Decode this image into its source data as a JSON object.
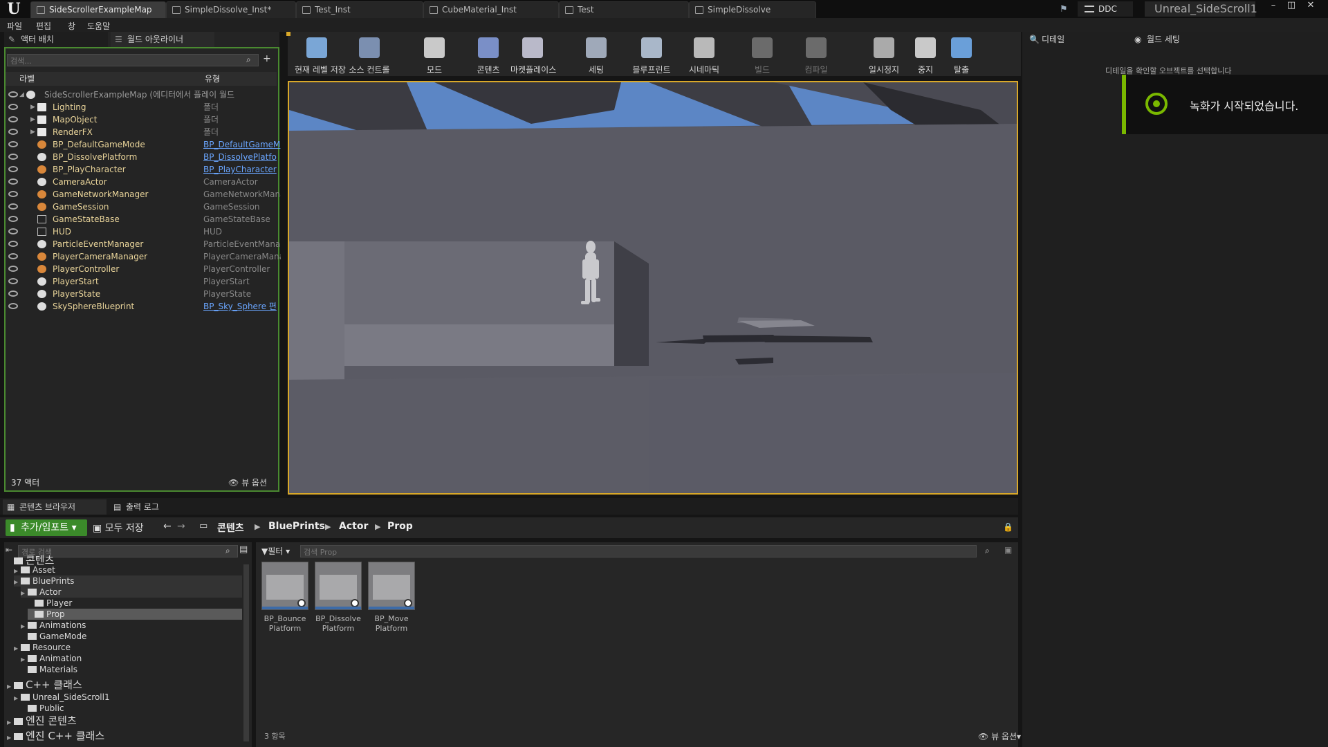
{
  "title_bar": {
    "tabs": [
      "SideScrollerExampleMap",
      "SimpleDissolve_Inst*",
      "Test_Inst",
      "CubeMaterial_Inst",
      "Test",
      "SimpleDissolve"
    ],
    "ddc": "DDC",
    "project": "Unreal_SideScroll1"
  },
  "menu": [
    "파일",
    "편집",
    "창",
    "도움말"
  ],
  "left_panel": {
    "tabs": [
      "액터 배치",
      "월드 아웃라이너"
    ],
    "search_placeholder": "검색...",
    "col_label": "라벨",
    "col_type": "유형",
    "rows": [
      {
        "label": "SideScrollerExampleMap (에디터에서 플레이 월드",
        "type": ""
      },
      {
        "label": "Lighting",
        "type": "폴더"
      },
      {
        "label": "MapObject",
        "type": "폴더"
      },
      {
        "label": "RenderFX",
        "type": "폴더"
      },
      {
        "label": "BP_DefaultGameMode",
        "type": "BP_DefaultGameM"
      },
      {
        "label": "BP_DissolvePlatform",
        "type": "BP_DissolvePlatfo"
      },
      {
        "label": "BP_PlayCharacter",
        "type": "BP_PlayCharacter"
      },
      {
        "label": "CameraActor",
        "type": "CameraActor"
      },
      {
        "label": "GameNetworkManager",
        "type": "GameNetworkManag"
      },
      {
        "label": "GameSession",
        "type": "GameSession"
      },
      {
        "label": "GameStateBase",
        "type": "GameStateBase"
      },
      {
        "label": "HUD",
        "type": "HUD"
      },
      {
        "label": "ParticleEventManager",
        "type": "ParticleEventManag"
      },
      {
        "label": "PlayerCameraManager",
        "type": "PlayerCameraMana"
      },
      {
        "label": "PlayerController",
        "type": "PlayerController"
      },
      {
        "label": "PlayerStart",
        "type": "PlayerStart"
      },
      {
        "label": "PlayerState",
        "type": "PlayerState"
      },
      {
        "label": "SkySphereBlueprint",
        "type": "BP_Sky_Sphere 편"
      }
    ],
    "actor_count": "37 액터",
    "view_options": "뷰 옵션"
  },
  "toolbar": [
    "현재 레벨 저장",
    "소스 컨트롤",
    "모드",
    "콘텐츠",
    "마켓플레이스",
    "세팅",
    "블루프린트",
    "시네마틱",
    "빌드",
    "컴파일",
    "일시정지",
    "중지",
    "탈출"
  ],
  "right_panel": {
    "tabs": [
      "디테일",
      "월드 세팅"
    ],
    "hint": "디테일을 확인할 오브젝트를 선택합니다",
    "toast": "녹화가 시작되었습니다."
  },
  "bottom": {
    "tabs": [
      "콘텐츠 브라우저",
      "출력 로그"
    ],
    "add_import": "추가/임포트",
    "save_all": "모두 저장",
    "breadcrumbs": [
      "콘텐츠",
      "BluePrints",
      "Actor",
      "Prop"
    ],
    "path_search_placeholder": "경로 검색",
    "filter": "필터",
    "asset_search_placeholder": "검색 Prop",
    "tree": [
      "콘텐츠",
      "Asset",
      "BluePrints",
      "Actor",
      "Player",
      "Prop",
      "Animations",
      "GameMode",
      "Resource",
      "Animation",
      "Materials",
      "C++ 클래스",
      "Unreal_SideScroll1",
      "Public",
      "엔진 콘텐츠",
      "엔진 C++ 클래스"
    ],
    "assets": [
      {
        "line1": "BP_Bounce",
        "line2": "Platform"
      },
      {
        "line1": "BP_Dissolve",
        "line2": "Platform"
      },
      {
        "line1": "BP_Move",
        "line2": "Platform"
      }
    ],
    "item_count": "3 항목",
    "view_options": "뷰 옵션"
  }
}
